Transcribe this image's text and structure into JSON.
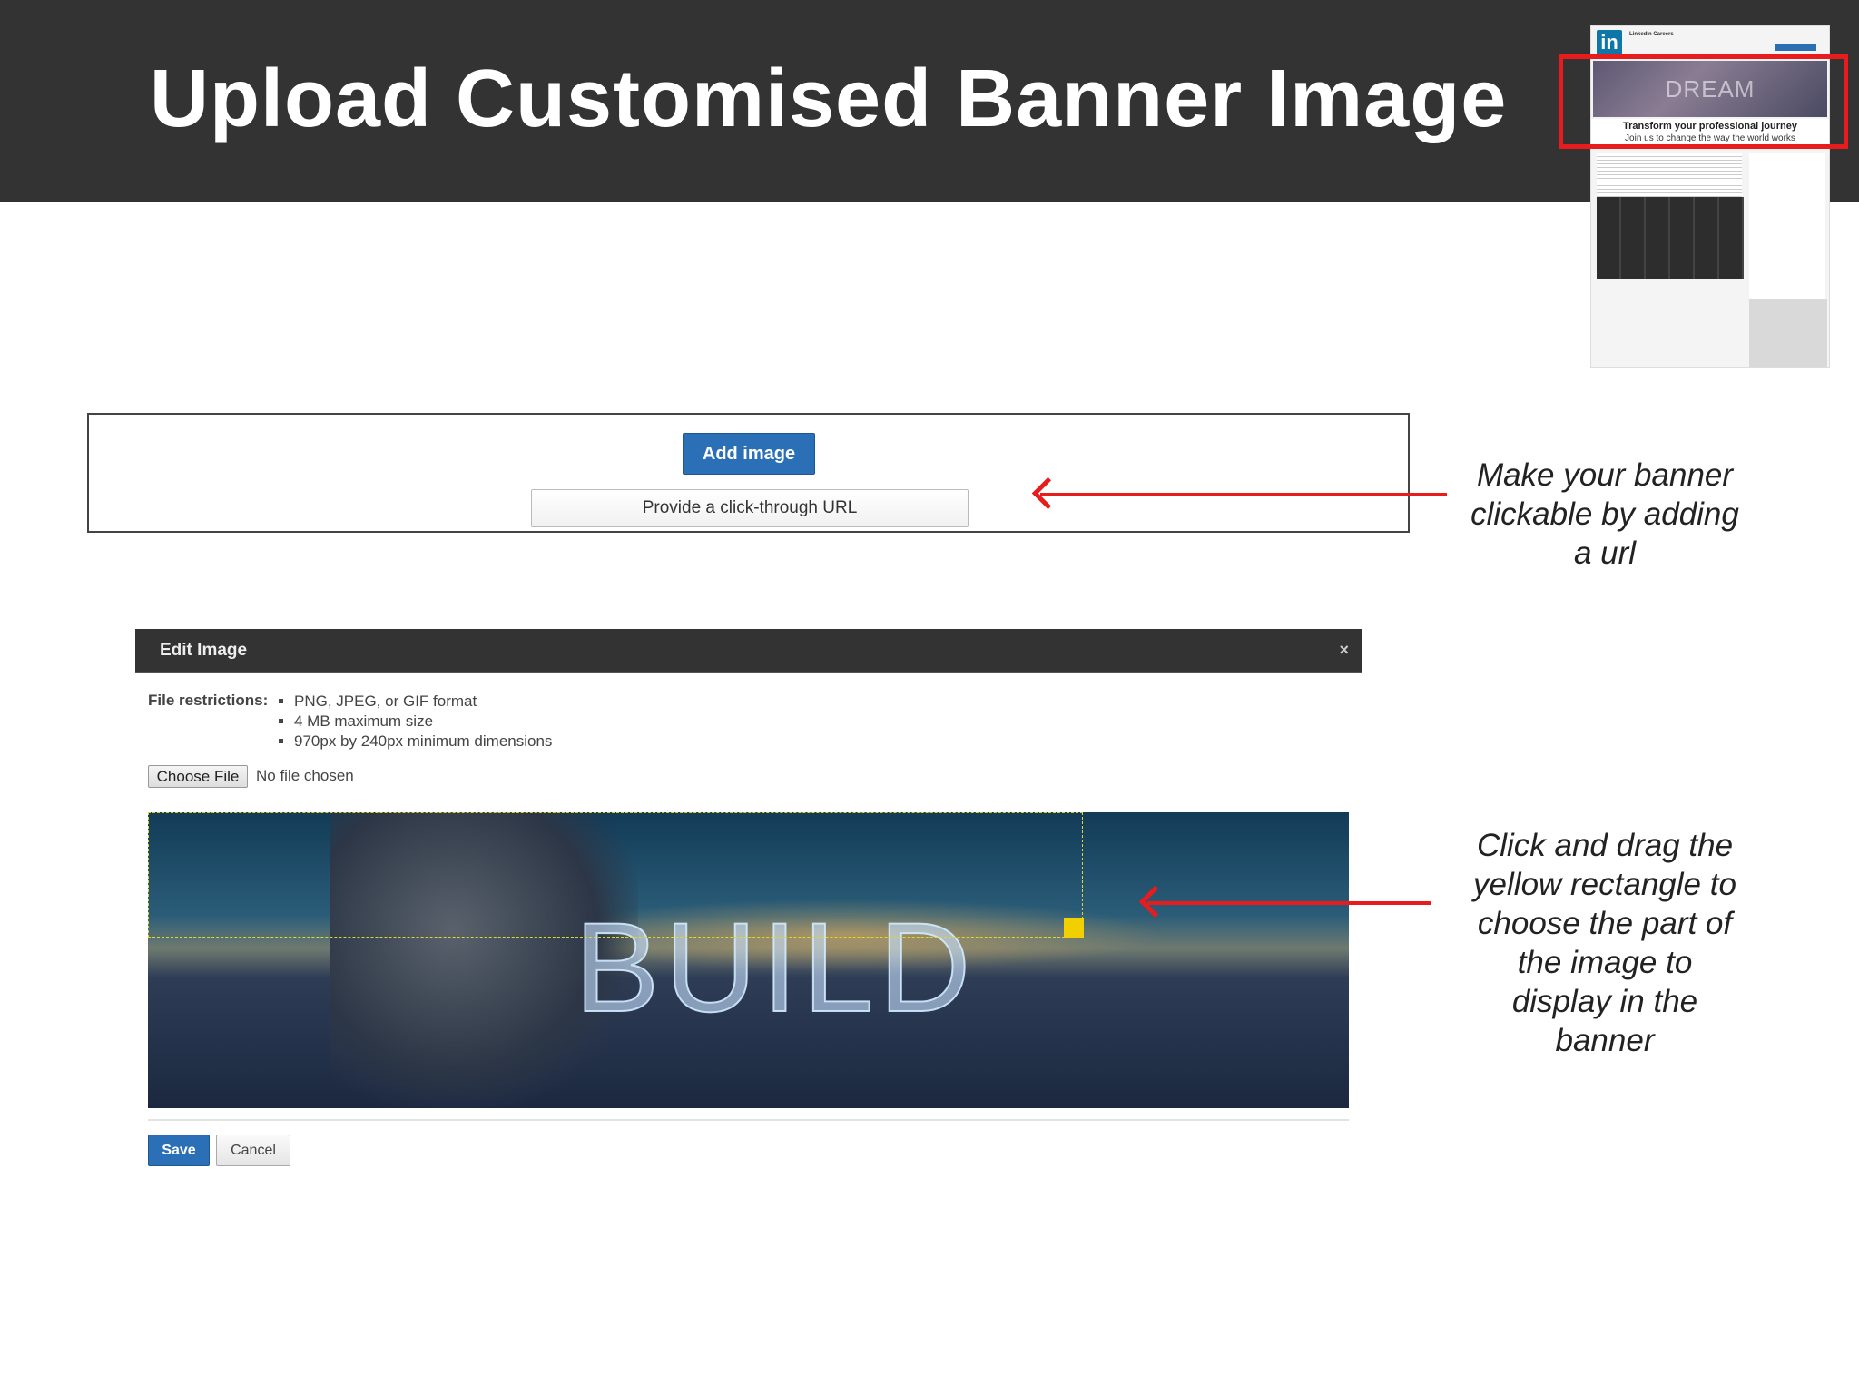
{
  "slide": {
    "title": "Upload Customised Banner Image"
  },
  "thumbnail": {
    "company": "LinkedIn Careers",
    "logo_text": "in",
    "banner_word": "DREAM",
    "tagline": "Transform your professional journey",
    "subtagline": "Join us to change the way the world works"
  },
  "banner_box": {
    "add_image_label": "Add image",
    "url_button_label": "Provide a click-through URL"
  },
  "notes": {
    "url_note_lines": [
      "Make your banner",
      "clickable by adding",
      "a url"
    ],
    "drag_note_lines": [
      "Click and drag the",
      "yellow rectangle to",
      "choose the part of",
      "the image to",
      "display in the",
      "banner"
    ]
  },
  "dialog": {
    "title": "Edit Image",
    "close_label": "×",
    "restrictions_label": "File restrictions:",
    "restrictions": [
      "PNG, JPEG, or GIF format",
      "4 MB maximum size",
      "970px by 240px minimum dimensions"
    ],
    "choose_file_label": "Choose File",
    "no_file_text": "No file chosen",
    "image_word": "BUILD",
    "save_label": "Save",
    "cancel_label": "Cancel"
  },
  "colors": {
    "accent": "#2b6fb6",
    "arrow": "#e81c1c",
    "crop": "#f2d000",
    "header": "#333333"
  }
}
